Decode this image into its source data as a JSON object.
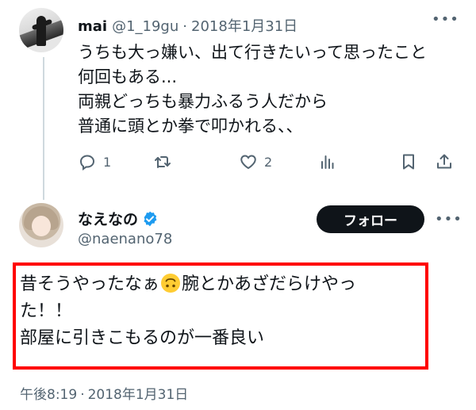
{
  "reply": {
    "name": "mai",
    "handle": "@1_19gu",
    "separator": "·",
    "date": "2018年1月31日",
    "lines": [
      "うちも大っ嫌い、出て行きたいって思ったこと",
      "何回もある...",
      "両親どっちも暴力ふるう人だから",
      "普通に頭とか拳で叩かれる、、"
    ],
    "actions": {
      "reply_count": "1",
      "retweet_count": "",
      "like_count": "2"
    }
  },
  "main": {
    "name": "なえなの",
    "handle": "@naenano78",
    "follow_label": "フォロー",
    "text_line1_a": "昔そうやったなぁ",
    "emoji": "upside-down-face",
    "text_line1_b": "腕とかあざだらけやっ",
    "text_line2": "た！！",
    "text_line3": "部屋に引きこもるのが一番良い",
    "time": "午後8:19",
    "separator": "·",
    "date": "2018年1月31日"
  },
  "colors": {
    "text": "#0f1419",
    "secondary": "#536471",
    "verified": "#1d9bf0",
    "highlight": "#ff0000",
    "button_bg": "#0f1419"
  },
  "icons": {
    "more": "more-horizontal-icon",
    "reply": "reply-icon",
    "retweet": "retweet-icon",
    "like": "heart-icon",
    "views": "analytics-icon",
    "bookmark": "bookmark-icon",
    "share": "share-icon",
    "verified": "verified-badge-icon"
  }
}
